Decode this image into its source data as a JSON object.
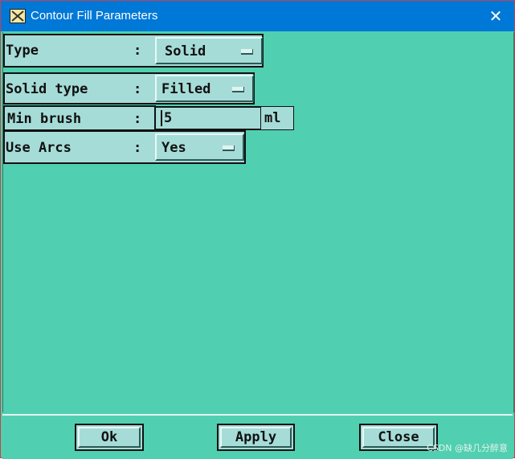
{
  "window": {
    "title": "Contour Fill Parameters",
    "close_glyph": "✕"
  },
  "rows": [
    {
      "label": "Type",
      "colon": ":",
      "value": "Solid"
    },
    {
      "label": "Solid type",
      "colon": ":",
      "value": "Filled"
    },
    {
      "label": "Min brush",
      "colon": ":",
      "value": "5",
      "unit": "ml"
    },
    {
      "label": "Use Arcs",
      "colon": ":",
      "value": "Yes"
    }
  ],
  "buttons": {
    "ok": "Ok",
    "apply": "Apply",
    "close": "Close"
  },
  "watermark": "CSDN @缺几分醉意",
  "colors": {
    "background": "#50d0b0",
    "widget": "#a6dcd8",
    "titlebar": "#0078d7"
  }
}
